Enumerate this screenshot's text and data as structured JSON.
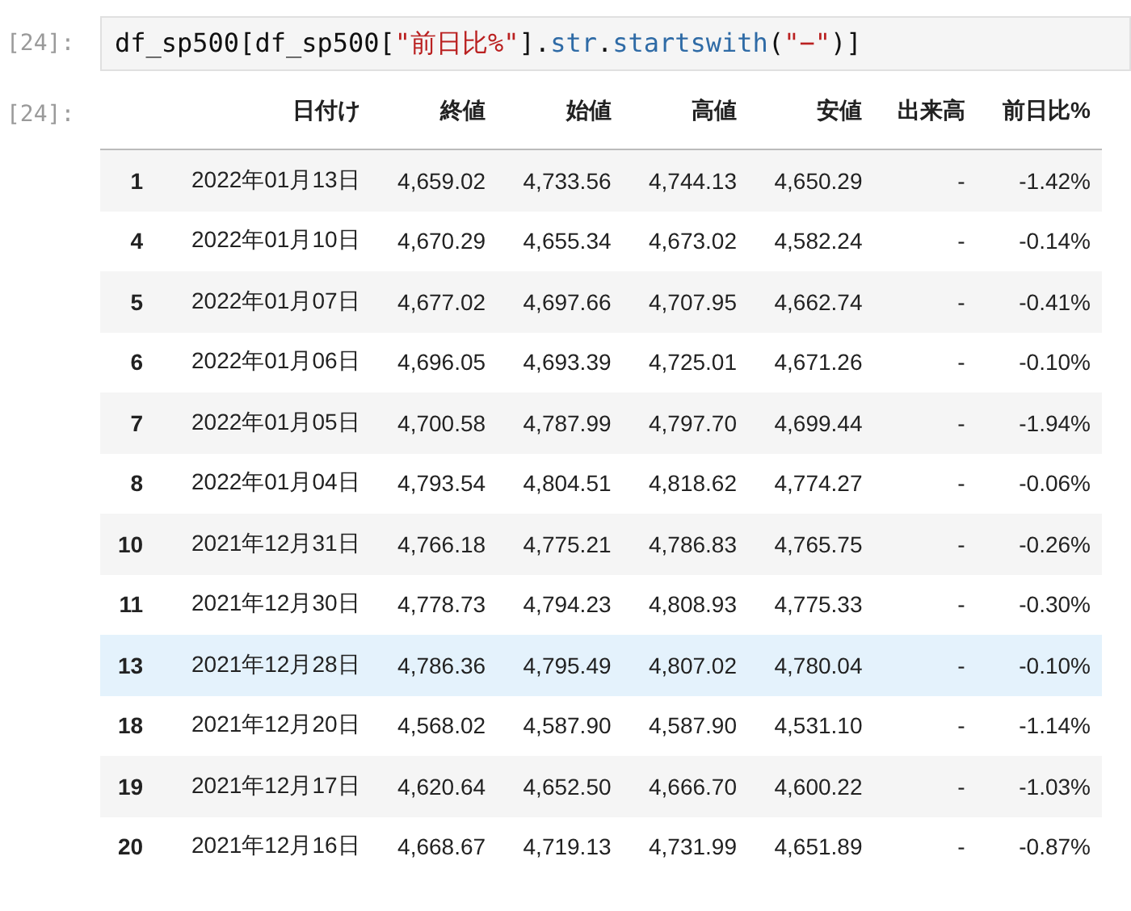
{
  "input_cell": {
    "prompt": "[24]:",
    "code": [
      {
        "kind": "plain",
        "text": "df_sp500[df_sp500["
      },
      {
        "kind": "string",
        "text": "\"前日比%\""
      },
      {
        "kind": "plain",
        "text": "]."
      },
      {
        "kind": "name",
        "text": "str"
      },
      {
        "kind": "plain",
        "text": "."
      },
      {
        "kind": "name",
        "text": "startswith"
      },
      {
        "kind": "plain",
        "text": "("
      },
      {
        "kind": "string",
        "text": "\"−\""
      },
      {
        "kind": "plain",
        "text": ")]"
      }
    ]
  },
  "output_cell": {
    "prompt": "[24]:",
    "table": {
      "columns": [
        "",
        "日付け",
        "終値",
        "始値",
        "高値",
        "安値",
        "出来高",
        "前日比%"
      ],
      "rows": [
        {
          "highlighted": false,
          "cells": [
            "1",
            "2022年01月13日",
            "4,659.02",
            "4,733.56",
            "4,744.13",
            "4,650.29",
            "-",
            "-1.42%"
          ]
        },
        {
          "highlighted": false,
          "cells": [
            "4",
            "2022年01月10日",
            "4,670.29",
            "4,655.34",
            "4,673.02",
            "4,582.24",
            "-",
            "-0.14%"
          ]
        },
        {
          "highlighted": false,
          "cells": [
            "5",
            "2022年01月07日",
            "4,677.02",
            "4,697.66",
            "4,707.95",
            "4,662.74",
            "-",
            "-0.41%"
          ]
        },
        {
          "highlighted": false,
          "cells": [
            "6",
            "2022年01月06日",
            "4,696.05",
            "4,693.39",
            "4,725.01",
            "4,671.26",
            "-",
            "-0.10%"
          ]
        },
        {
          "highlighted": false,
          "cells": [
            "7",
            "2022年01月05日",
            "4,700.58",
            "4,787.99",
            "4,797.70",
            "4,699.44",
            "-",
            "-1.94%"
          ]
        },
        {
          "highlighted": false,
          "cells": [
            "8",
            "2022年01月04日",
            "4,793.54",
            "4,804.51",
            "4,818.62",
            "4,774.27",
            "-",
            "-0.06%"
          ]
        },
        {
          "highlighted": false,
          "cells": [
            "10",
            "2021年12月31日",
            "4,766.18",
            "4,775.21",
            "4,786.83",
            "4,765.75",
            "-",
            "-0.26%"
          ]
        },
        {
          "highlighted": false,
          "cells": [
            "11",
            "2021年12月30日",
            "4,778.73",
            "4,794.23",
            "4,808.93",
            "4,775.33",
            "-",
            "-0.30%"
          ]
        },
        {
          "highlighted": true,
          "cells": [
            "13",
            "2021年12月28日",
            "4,786.36",
            "4,795.49",
            "4,807.02",
            "4,780.04",
            "-",
            "-0.10%"
          ]
        },
        {
          "highlighted": false,
          "cells": [
            "18",
            "2021年12月20日",
            "4,568.02",
            "4,587.90",
            "4,587.90",
            "4,531.10",
            "-",
            "-1.14%"
          ]
        },
        {
          "highlighted": false,
          "cells": [
            "19",
            "2021年12月17日",
            "4,620.64",
            "4,652.50",
            "4,666.70",
            "4,600.22",
            "-",
            "-1.03%"
          ]
        },
        {
          "highlighted": false,
          "cells": [
            "20",
            "2021年12月16日",
            "4,668.67",
            "4,719.13",
            "4,731.99",
            "4,651.89",
            "-",
            "-0.87%"
          ]
        }
      ]
    }
  }
}
